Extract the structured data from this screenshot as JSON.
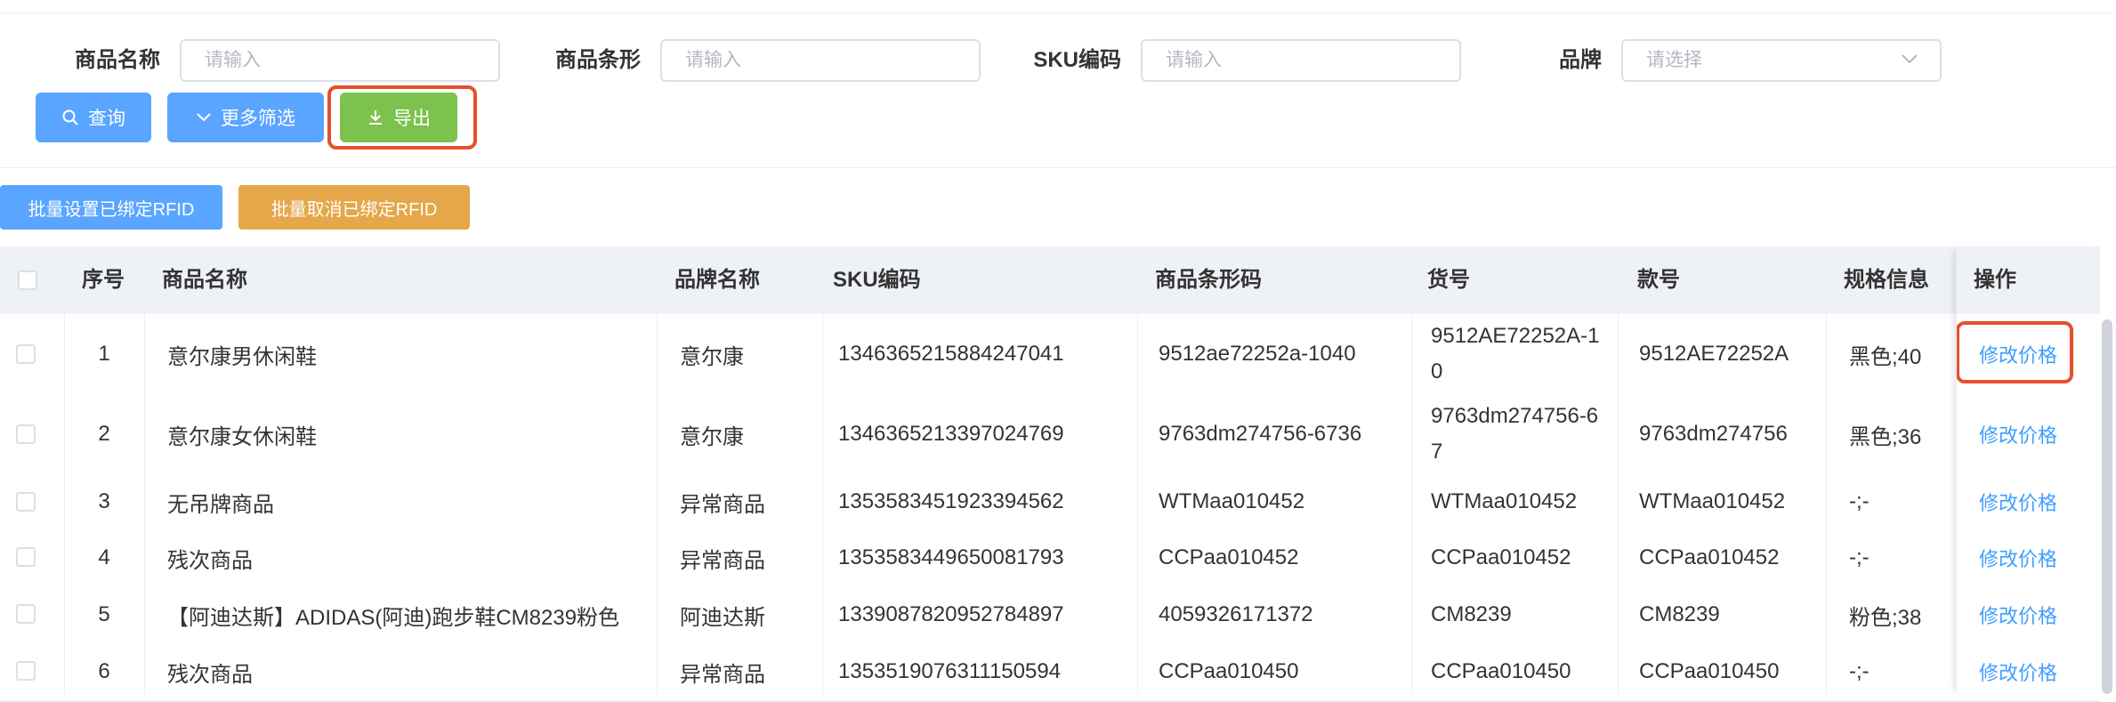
{
  "filters": {
    "name_label": "商品名称",
    "name_placeholder": "请输入",
    "barcode_label": "商品条形",
    "barcode_placeholder": "请输入",
    "sku_label": "SKU编码",
    "sku_placeholder": "请输入",
    "brand_label": "品牌",
    "brand_placeholder": "请选择"
  },
  "actions": {
    "query": "查询",
    "more_filters": "更多筛选",
    "export": "导出",
    "batch_set_rfid": "批量设置已绑定RFID",
    "batch_cancel_rfid": "批量取消已绑定RFID"
  },
  "table": {
    "headers": {
      "index": "序号",
      "name": "商品名称",
      "brand": "品牌名称",
      "sku": "SKU编码",
      "barcode": "商品条形码",
      "item_no": "货号",
      "style_no": "款号",
      "spec": "规格信息",
      "op": "操作"
    },
    "rows": [
      {
        "index": "1",
        "name": "意尔康男休闲鞋",
        "brand": "意尔康",
        "sku": "1346365215884247041",
        "barcode": "9512ae72252a-1040",
        "item_no": "9512AE72252A-10",
        "style_no": "9512AE72252A",
        "spec": "黑色;40",
        "op": "修改价格"
      },
      {
        "index": "2",
        "name": "意尔康女休闲鞋",
        "brand": "意尔康",
        "sku": "1346365213397024769",
        "barcode": "9763dm274756-6736",
        "item_no": "9763dm274756-67",
        "style_no": "9763dm274756",
        "spec": "黑色;36",
        "op": "修改价格"
      },
      {
        "index": "3",
        "name": "无吊牌商品",
        "brand": "异常商品",
        "sku": "1353583451923394562",
        "barcode": "WTMaa010452",
        "item_no": "WTMaa010452",
        "style_no": "WTMaa010452",
        "spec": "-;-",
        "op": "修改价格"
      },
      {
        "index": "4",
        "name": "残次商品",
        "brand": "异常商品",
        "sku": "1353583449650081793",
        "barcode": "CCPaa010452",
        "item_no": "CCPaa010452",
        "style_no": "CCPaa010452",
        "spec": "-;-",
        "op": "修改价格"
      },
      {
        "index": "5",
        "name": "【阿迪达斯】ADIDAS(阿迪)跑步鞋CM8239粉色",
        "brand": "阿迪达斯",
        "sku": "1339087820952784897",
        "barcode": "4059326171372",
        "item_no": "CM8239",
        "style_no": "CM8239",
        "spec": "粉色;38",
        "op": "修改价格"
      },
      {
        "index": "6",
        "name": "残次商品",
        "brand": "异常商品",
        "sku": "1353519076311150594",
        "barcode": "CCPaa010450",
        "item_no": "CCPaa010450",
        "style_no": "CCPaa010450",
        "spec": "-;-",
        "op": "修改价格"
      }
    ]
  },
  "colors": {
    "primary": "#5aa5ff",
    "export_green": "#7ec24e",
    "warning_orange": "#e6a74a",
    "highlight_red": "#e5512b",
    "link_blue": "#409eff",
    "header_bg": "#eef1f6"
  },
  "icons": {
    "query": "search-icon",
    "more_filters": "chevron-down-icon",
    "export": "download-icon",
    "brand_select": "chevron-down-icon"
  }
}
